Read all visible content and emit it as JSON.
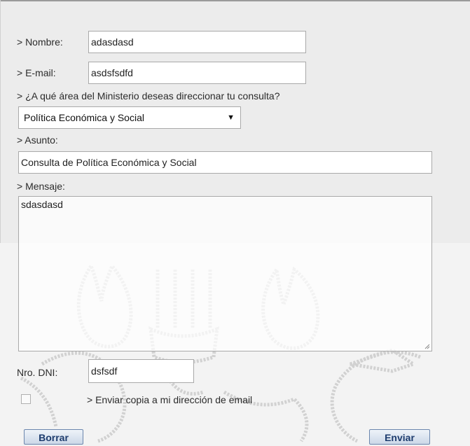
{
  "form": {
    "nombre": {
      "label": "> Nombre:",
      "value": "adasdasd"
    },
    "email": {
      "label": "> E-mail:",
      "value": "asdsfsdfd"
    },
    "area": {
      "label": "> ¿A qué área del Ministerio deseas direccionar tu consulta?",
      "selected": "Política Económica y Social"
    },
    "asunto": {
      "label": "> Asunto:",
      "value": "Consulta de Política Económica y Social"
    },
    "mensaje": {
      "label": "> Mensaje:",
      "value": "sdasdasd"
    },
    "dni": {
      "label": "Nro. DNI:",
      "value": "dsfsdf"
    },
    "copy": {
      "label": "> Enviar copia a mi dirección de email",
      "checked": false
    },
    "buttons": {
      "reset": "Borrar",
      "submit": "Enviar"
    }
  },
  "icons": {
    "select_arrow": "▼",
    "resize_grip": "resize-grip-icon"
  }
}
